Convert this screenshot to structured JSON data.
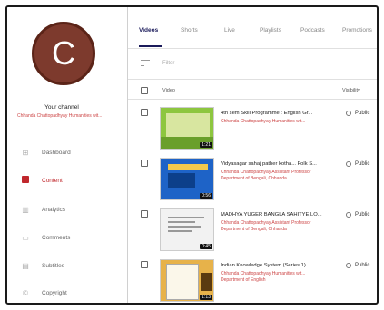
{
  "sidebar": {
    "avatar_letter": "C",
    "channel_title": "Your channel",
    "channel_subtitle": "Chhanda Chattopadhyay Humanities wit...",
    "nav": [
      {
        "label": "Dashboard",
        "icon": "dashboard-icon",
        "glyph": "⊞",
        "active": false
      },
      {
        "label": "Content",
        "icon": "content-icon",
        "glyph": "▶",
        "active": true
      },
      {
        "label": "Analytics",
        "icon": "analytics-icon",
        "glyph": "▥",
        "active": false
      },
      {
        "label": "Comments",
        "icon": "comments-icon",
        "glyph": "▭",
        "active": false
      },
      {
        "label": "Subtitles",
        "icon": "subtitles-icon",
        "glyph": "▤",
        "active": false
      },
      {
        "label": "Copyright",
        "icon": "copyright-icon",
        "glyph": "©",
        "active": false
      }
    ]
  },
  "tabs": [
    "Videos",
    "Shorts",
    "Live",
    "Playlists",
    "Podcasts",
    "Promotions"
  ],
  "active_tab": "Videos",
  "filter": {
    "placeholder": "Filter"
  },
  "table": {
    "header_video": "Video",
    "header_visibility": "Visibility"
  },
  "videos": [
    {
      "title": "4th sem Skill Programme : English Gr...",
      "description": "Chhanda Chattopadhyay Humanities wit...",
      "duration": "1:21",
      "visibility": "Public"
    },
    {
      "title": "Vidyasagar sahaj pather kotha... Folk S...",
      "description": "Chhanda Chattopadhyay Assistant Professor Department of Bengali, Chhanda",
      "duration": "0:56",
      "visibility": "Public"
    },
    {
      "title": "MADHYA YUGER BANGLA SAHITYE LO...",
      "description": "Chhanda Chattopadhyay Assistant Professor Department of Bengali, Chhanda",
      "duration": "0:45",
      "visibility": "Public"
    },
    {
      "title": "Indian Knowledge System (Series 1)...",
      "description": "Chhanda Chattopadhyay Humanities wit... Department of English",
      "duration": "1:13",
      "visibility": "Public"
    }
  ]
}
